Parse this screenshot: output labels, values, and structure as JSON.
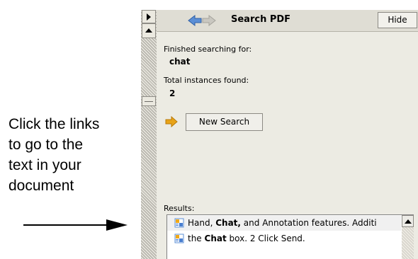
{
  "callout": {
    "lines": [
      "Click the links",
      "to go to the",
      "text in your",
      "document"
    ]
  },
  "panel": {
    "title": "Search PDF",
    "hide_label": "Hide",
    "back_icon": "back-arrow-icon",
    "forward_icon": "forward-arrow-icon",
    "finished_label": "Finished searching for:",
    "search_term": "chat",
    "total_label": "Total instances found:",
    "total_count": "2",
    "new_search_label": "New Search",
    "results_label": "Results:",
    "results": [
      {
        "pre": "Hand, ",
        "match": "Chat,",
        "post": " and Annotation features. Additi"
      },
      {
        "pre": "the ",
        "match": "Chat",
        "post": " box. 2 Click Send."
      }
    ]
  },
  "colors": {
    "accent_arrow": "#e8a317",
    "nav_blue": "#5b8fd6",
    "panel_bg": "#ecebe3"
  }
}
